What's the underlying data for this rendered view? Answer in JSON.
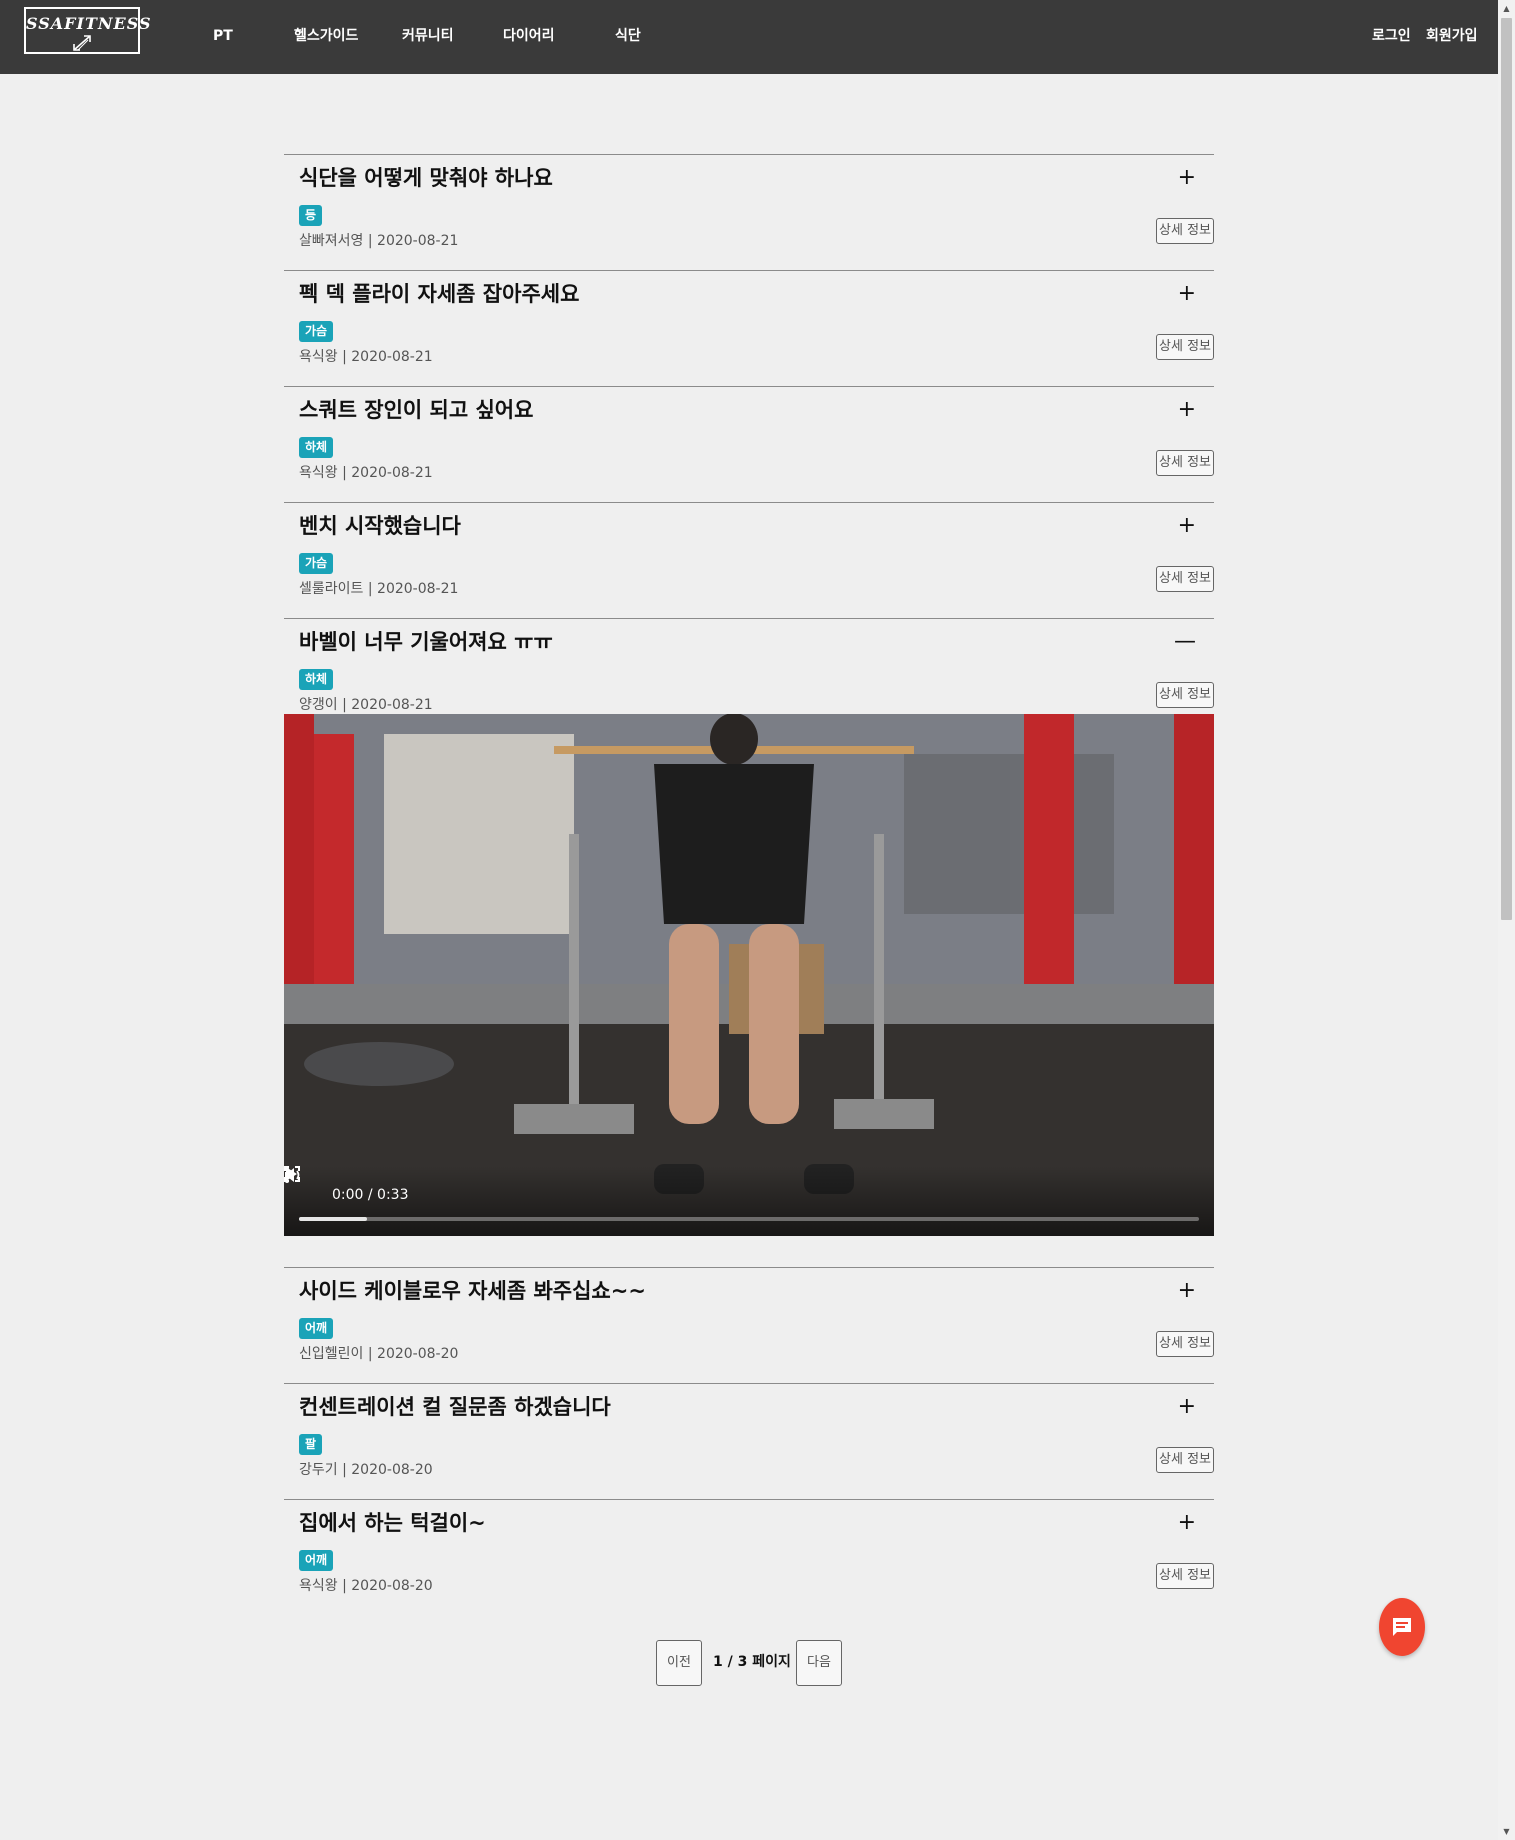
{
  "header": {
    "logo_text": "SSAFITNESS",
    "nav": [
      "PT",
      "헬스가이드",
      "커뮤니티",
      "다이어리",
      "식단"
    ],
    "login": "로그인",
    "signup": "회원가입"
  },
  "posts": [
    {
      "title": "식단을 어떻게 맞춰야 하나요",
      "tag": "등",
      "author": "살빠져서영",
      "date": "2020-08-21",
      "toggle": "+",
      "detail": "상세 정보"
    },
    {
      "title": "펙 덱 플라이 자세좀 잡아주세요",
      "tag": "가슴",
      "author": "욕식왕",
      "date": "2020-08-21",
      "toggle": "+",
      "detail": "상세 정보"
    },
    {
      "title": "스쿼트 장인이 되고 싶어요",
      "tag": "하체",
      "author": "욕식왕",
      "date": "2020-08-21",
      "toggle": "+",
      "detail": "상세 정보"
    },
    {
      "title": "벤치 시작했습니다",
      "tag": "가슴",
      "author": "셀룰라이트",
      "date": "2020-08-21",
      "toggle": "+",
      "detail": "상세 정보"
    },
    {
      "title": "바벨이 너무 기울어져요 ㅠㅠ",
      "tag": "하체",
      "author": "양갱이",
      "date": "2020-08-21",
      "toggle": "—",
      "detail": "상세 정보",
      "video": {
        "time": "0:00 / 0:33",
        "progress": 0.075
      }
    },
    {
      "title": "사이드 케이블로우 자세좀 봐주십쇼~~",
      "tag": "어깨",
      "author": "신입헬린이",
      "date": "2020-08-20",
      "toggle": "+",
      "detail": "상세 정보"
    },
    {
      "title": "컨센트레이션 컬 질문좀 하겠습니다",
      "tag": "팔",
      "author": "강두기",
      "date": "2020-08-20",
      "toggle": "+",
      "detail": "상세 정보"
    },
    {
      "title": "집에서 하는 턱걸이~",
      "tag": "어깨",
      "author": "욕식왕",
      "date": "2020-08-20",
      "toggle": "+",
      "detail": "상세 정보"
    }
  ],
  "pagination": {
    "prev": "이전",
    "info": "1 / 3 페이지",
    "next": "다음"
  },
  "colors": {
    "navbar": "#3a3a3a",
    "tag": "#1aa3b8",
    "chat_fab": "#f04530",
    "background": "#efefef"
  },
  "icons": {
    "chat": "chat-bubble-icon",
    "play": "play-icon",
    "volume": "volume-icon",
    "fullscreen": "fullscreen-icon",
    "more": "more-vert-icon"
  }
}
